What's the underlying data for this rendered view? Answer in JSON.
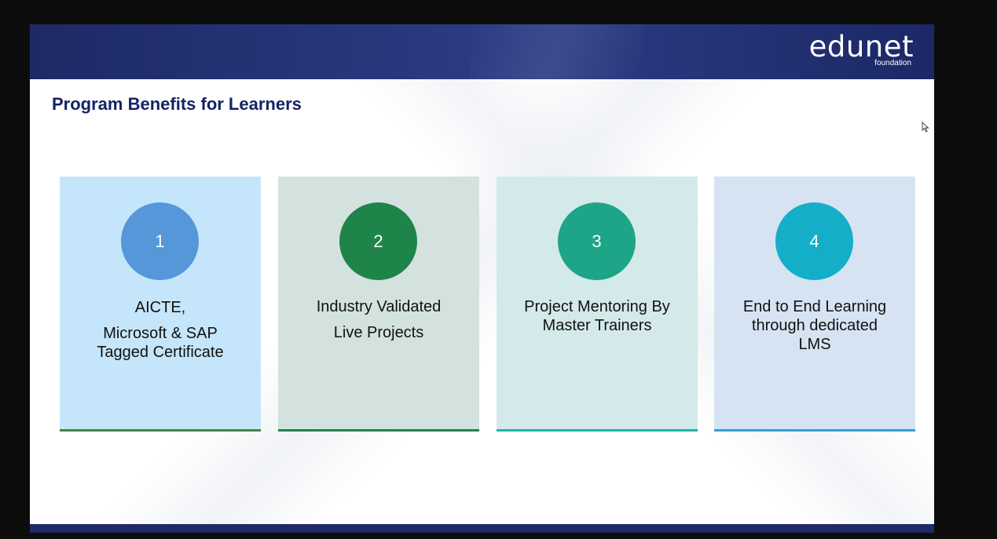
{
  "logo": {
    "word": "edunet",
    "sub": "foundation"
  },
  "title": "Program Benefits for Learners",
  "cards": [
    {
      "number": "1",
      "lines": [
        "AICTE,",
        "Microsoft & SAP",
        "Tagged Certificate"
      ],
      "circle_color": "#5597d9",
      "bg_color": "#c5e6fa",
      "rule_color": "#3b8a3e"
    },
    {
      "number": "2",
      "lines": [
        "Industry Validated",
        "Live Projects"
      ],
      "circle_color": "#1e8449",
      "bg_color": "#d3e2de",
      "rule_color": "#1e8449"
    },
    {
      "number": "3",
      "lines": [
        "Project Mentoring By",
        "Master Trainers"
      ],
      "circle_color": "#1ea486",
      "bg_color": "#d4e9ea",
      "rule_color": "#1fb3a5"
    },
    {
      "number": "4",
      "lines": [
        "End to End Learning",
        "through dedicated",
        "LMS"
      ],
      "circle_color": "#15aec8",
      "bg_color": "#d6e3f2",
      "rule_color": "#2fa0d8"
    }
  ]
}
